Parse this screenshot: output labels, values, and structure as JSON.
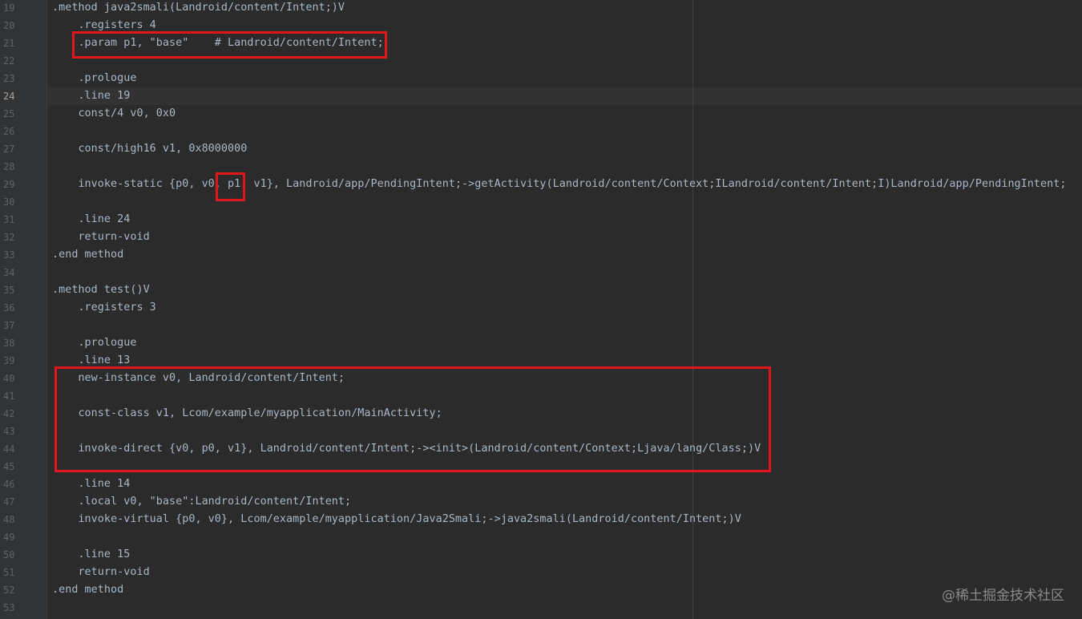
{
  "editor": {
    "current_line": 24,
    "lines": [
      {
        "num": "19",
        "code": ".method java2smali(Landroid/content/Intent;)V"
      },
      {
        "num": "20",
        "code": "    .registers 4"
      },
      {
        "num": "21",
        "code": "    .param p1, \"base\"    # Landroid/content/Intent;"
      },
      {
        "num": "22",
        "code": ""
      },
      {
        "num": "23",
        "code": "    .prologue"
      },
      {
        "num": "24",
        "code": "    .line 19"
      },
      {
        "num": "25",
        "code": "    const/4 v0, 0x0"
      },
      {
        "num": "26",
        "code": ""
      },
      {
        "num": "27",
        "code": "    const/high16 v1, 0x8000000"
      },
      {
        "num": "28",
        "code": ""
      },
      {
        "num": "29",
        "code": "    invoke-static {p0, v0, p1, v1}, Landroid/app/PendingIntent;->getActivity(Landroid/content/Context;ILandroid/content/Intent;I)Landroid/app/PendingIntent;"
      },
      {
        "num": "30",
        "code": ""
      },
      {
        "num": "31",
        "code": "    .line 24"
      },
      {
        "num": "32",
        "code": "    return-void"
      },
      {
        "num": "33",
        "code": ".end method"
      },
      {
        "num": "34",
        "code": ""
      },
      {
        "num": "35",
        "code": ".method test()V"
      },
      {
        "num": "36",
        "code": "    .registers 3"
      },
      {
        "num": "37",
        "code": ""
      },
      {
        "num": "38",
        "code": "    .prologue"
      },
      {
        "num": "39",
        "code": "    .line 13"
      },
      {
        "num": "40",
        "code": "    new-instance v0, Landroid/content/Intent;"
      },
      {
        "num": "41",
        "code": ""
      },
      {
        "num": "42",
        "code": "    const-class v1, Lcom/example/myapplication/MainActivity;"
      },
      {
        "num": "43",
        "code": ""
      },
      {
        "num": "44",
        "code": "    invoke-direct {v0, p0, v1}, Landroid/content/Intent;-><init>(Landroid/content/Context;Ljava/lang/Class;)V"
      },
      {
        "num": "45",
        "code": ""
      },
      {
        "num": "46",
        "code": "    .line 14"
      },
      {
        "num": "47",
        "code": "    .local v0, \"base\":Landroid/content/Intent;"
      },
      {
        "num": "48",
        "code": "    invoke-virtual {p0, v0}, Lcom/example/myapplication/Java2Smali;->java2smali(Landroid/content/Intent;)V"
      },
      {
        "num": "49",
        "code": ""
      },
      {
        "num": "50",
        "code": "    .line 15"
      },
      {
        "num": "51",
        "code": "    return-void"
      },
      {
        "num": "52",
        "code": ".end method"
      },
      {
        "num": "53",
        "code": ""
      }
    ]
  },
  "colors": {
    "background": "#2b2b2b",
    "gutter": "#313335",
    "code_text": "#a9b7c6",
    "line_number": "#606366",
    "highlight_box": "#e1161d"
  },
  "watermark": "@稀土掘金技术社区"
}
